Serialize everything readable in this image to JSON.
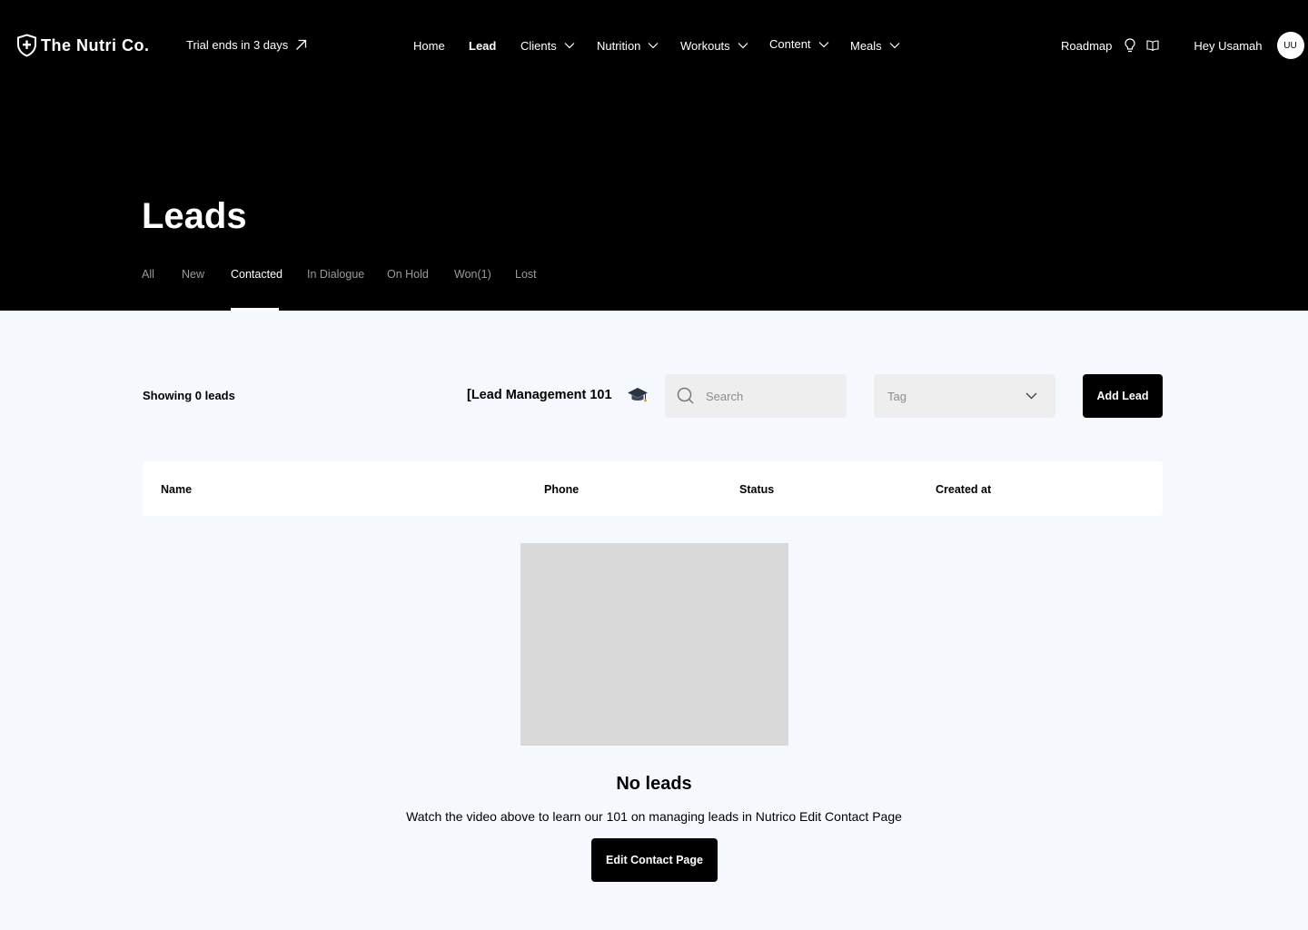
{
  "brand": {
    "name": "The Nutri Co."
  },
  "trial": {
    "text": "Trial ends in 3 days"
  },
  "nav": {
    "items": [
      {
        "label": "Home",
        "dropdown": false,
        "active": false
      },
      {
        "label": "Lead",
        "dropdown": false,
        "active": true
      },
      {
        "label": "Clients",
        "dropdown": true,
        "active": false
      },
      {
        "label": "Nutrition",
        "dropdown": true,
        "active": false
      },
      {
        "label": "Workouts",
        "dropdown": true,
        "active": false
      },
      {
        "label": "Content",
        "dropdown": true,
        "active": false
      },
      {
        "label": "Meals",
        "dropdown": true,
        "active": false
      }
    ],
    "roadmap": "Roadmap",
    "greeting": "Hey Usamah",
    "avatar_initials": "UU"
  },
  "page": {
    "title": "Leads",
    "tabs": [
      {
        "label": "All",
        "active": false
      },
      {
        "label": "New",
        "active": false
      },
      {
        "label": "Contacted",
        "active": true
      },
      {
        "label": "In Dialogue",
        "active": false
      },
      {
        "label": "On Hold",
        "active": false
      },
      {
        "label": "Won(1)",
        "active": false
      },
      {
        "label": "Lost",
        "active": false
      }
    ]
  },
  "toolbar": {
    "showing": "Showing 0 leads",
    "tutorial_label": "[Lead Management 101",
    "search_placeholder": "Search",
    "search_value": "",
    "tag_placeholder": "Tag",
    "add_label": "Add Lead"
  },
  "table": {
    "columns": [
      "Name",
      "Phone",
      "Status",
      "Created at"
    ],
    "rows": []
  },
  "empty_state": {
    "title": "No leads",
    "description": "Watch the video above to learn our 101 on managing leads in Nutrico Edit Contact Page",
    "button_label": "Edit Contact Page"
  },
  "colors": {
    "header_bg": "#000000",
    "page_bg": "#f5f9fd",
    "accent": "#000000",
    "input_bg": "#eeeeee",
    "video_placeholder": "#d9d9d9"
  },
  "icons": [
    "shield-plus-icon",
    "arrow-up-right-icon",
    "chevron-down-icon",
    "lightbulb-icon",
    "book-icon",
    "graduation-cap-icon",
    "search-icon"
  ]
}
